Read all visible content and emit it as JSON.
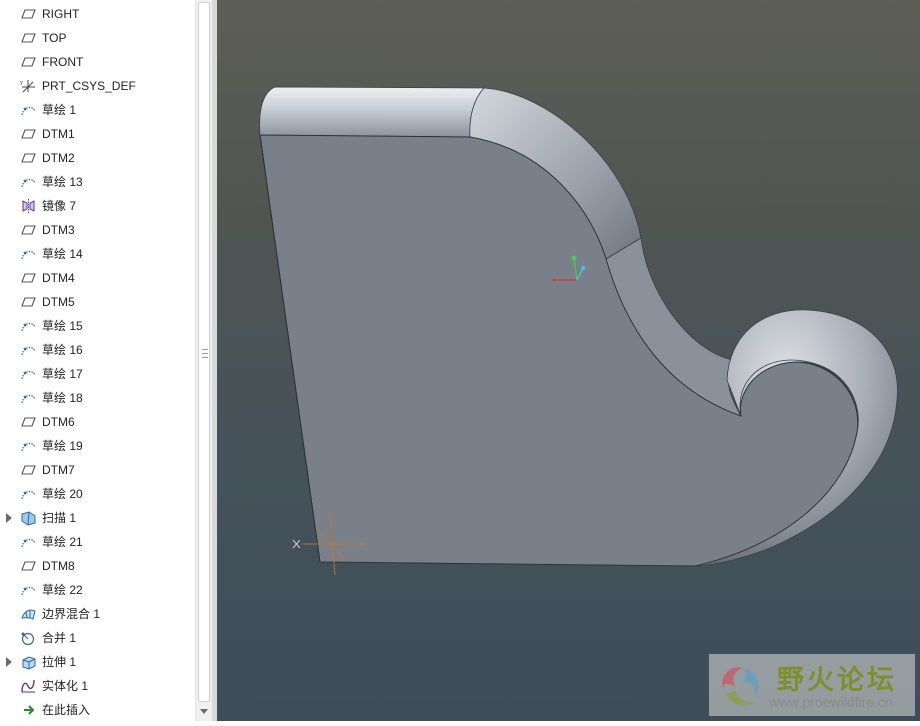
{
  "model_tree": {
    "items": [
      {
        "label": "RIGHT",
        "icon": "datum-plane-icon",
        "expandable": false
      },
      {
        "label": "TOP",
        "icon": "datum-plane-icon",
        "expandable": false
      },
      {
        "label": "FRONT",
        "icon": "datum-plane-icon",
        "expandable": false
      },
      {
        "label": "PRT_CSYS_DEF",
        "icon": "coordinate-system-icon",
        "expandable": false
      },
      {
        "label": "草绘 1",
        "icon": "sketch-icon",
        "expandable": false
      },
      {
        "label": "DTM1",
        "icon": "datum-plane-icon",
        "expandable": false
      },
      {
        "label": "DTM2",
        "icon": "datum-plane-icon",
        "expandable": false
      },
      {
        "label": "草绘 13",
        "icon": "sketch-icon",
        "expandable": false
      },
      {
        "label": "镜像 7",
        "icon": "mirror-icon",
        "expandable": false
      },
      {
        "label": "DTM3",
        "icon": "datum-plane-icon",
        "expandable": false
      },
      {
        "label": "草绘 14",
        "icon": "sketch-icon",
        "expandable": false
      },
      {
        "label": "DTM4",
        "icon": "datum-plane-icon",
        "expandable": false
      },
      {
        "label": "DTM5",
        "icon": "datum-plane-icon",
        "expandable": false
      },
      {
        "label": "草绘 15",
        "icon": "sketch-icon",
        "expandable": false
      },
      {
        "label": "草绘 16",
        "icon": "sketch-icon",
        "expandable": false
      },
      {
        "label": "草绘 17",
        "icon": "sketch-icon",
        "expandable": false
      },
      {
        "label": "草绘 18",
        "icon": "sketch-icon",
        "expandable": false
      },
      {
        "label": "DTM6",
        "icon": "datum-plane-icon",
        "expandable": false
      },
      {
        "label": "草绘 19",
        "icon": "sketch-icon",
        "expandable": false
      },
      {
        "label": "DTM7",
        "icon": "datum-plane-icon",
        "expandable": false
      },
      {
        "label": "草绘 20",
        "icon": "sketch-icon",
        "expandable": false
      },
      {
        "label": "扫描 1",
        "icon": "sweep-icon",
        "expandable": true
      },
      {
        "label": "草绘 21",
        "icon": "sketch-icon",
        "expandable": false
      },
      {
        "label": "DTM8",
        "icon": "datum-plane-icon",
        "expandable": false
      },
      {
        "label": "草绘 22",
        "icon": "sketch-icon",
        "expandable": false
      },
      {
        "label": "边界混合 1",
        "icon": "boundary-blend-icon",
        "expandable": false
      },
      {
        "label": "合并 1",
        "icon": "merge-icon",
        "expandable": false
      },
      {
        "label": "拉伸 1",
        "icon": "extrude-icon",
        "expandable": true
      },
      {
        "label": "实体化 1",
        "icon": "solidify-icon",
        "expandable": false
      },
      {
        "label": "在此插入",
        "icon": "insert-here-arrow-icon",
        "expandable": false
      }
    ]
  },
  "watermark": {
    "title": "野火论坛",
    "url": "www.proewildfire.cn"
  },
  "colors": {
    "model_face": "#7a808a",
    "model_highlight": "#c9ced6",
    "axis_x": "#e23a2a",
    "axis_y": "#3fd24a",
    "axis_z": "#3fc8e6",
    "csys": "#b8773a",
    "watermark_green": "#7f8f2e"
  }
}
